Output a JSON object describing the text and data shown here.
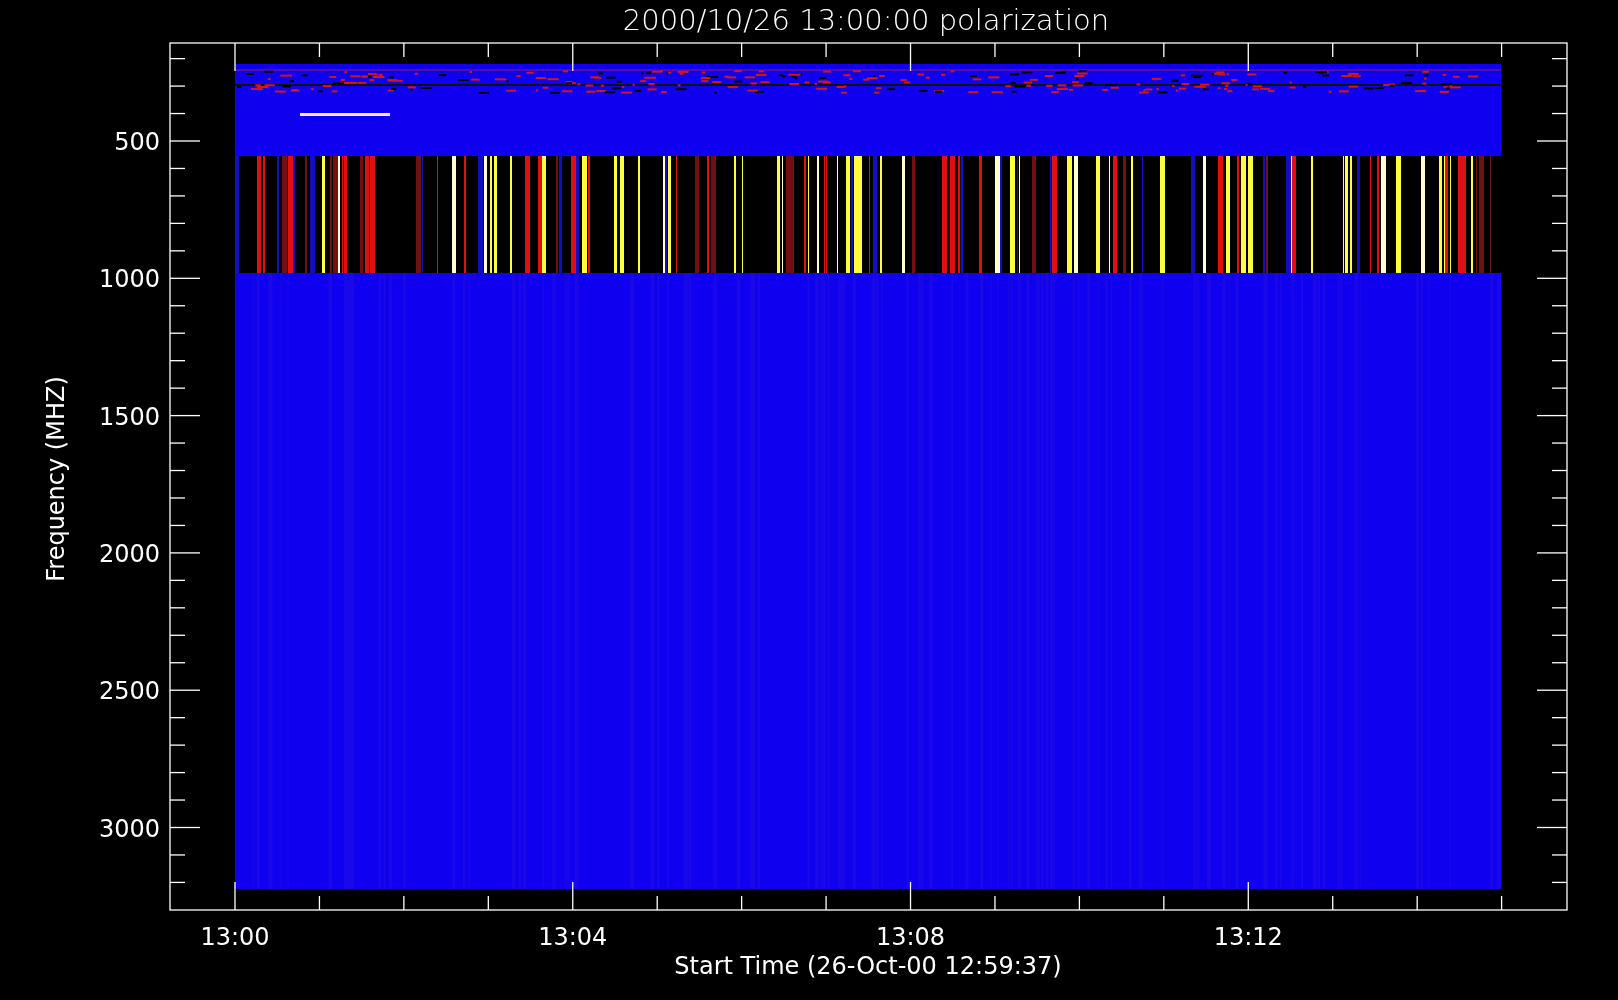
{
  "title": "2000/10/26 13:00:00 polarization",
  "y_axis": {
    "label": "Frequency (MHZ)",
    "ticks": [
      "500",
      "1000",
      "1500",
      "2000",
      "2500",
      "3000"
    ]
  },
  "x_axis": {
    "label": "Start Time (26-Oct-00 12:59:37)",
    "ticks": [
      "13:00",
      "13:04",
      "13:08",
      "13:12"
    ]
  }
}
